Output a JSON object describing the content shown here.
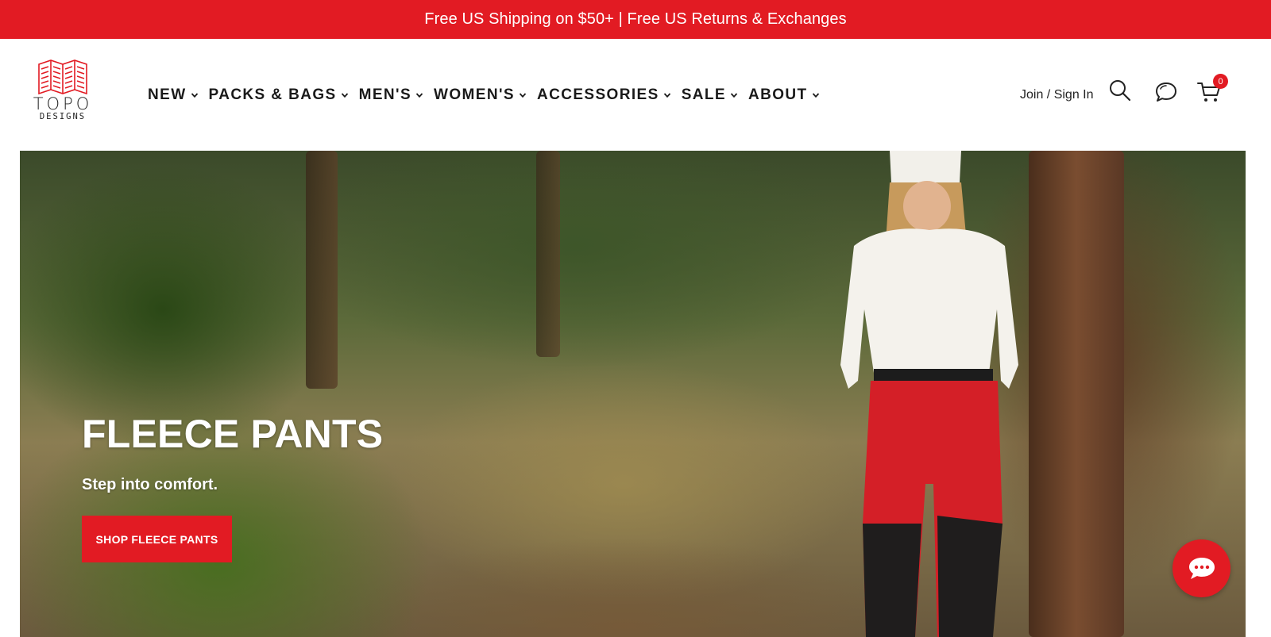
{
  "promo": {
    "text": "Free US Shipping on $50+ | Free US Returns & Exchanges"
  },
  "brand": {
    "line1": "TOPO",
    "line2": "DESIGNS",
    "accent": "#e21b23"
  },
  "nav": {
    "items": [
      {
        "label": "NEW"
      },
      {
        "label": "PACKS & BAGS"
      },
      {
        "label": "MEN'S"
      },
      {
        "label": "WOMEN'S"
      },
      {
        "label": "ACCESSORIES"
      },
      {
        "label": "SALE"
      },
      {
        "label": "ABOUT"
      }
    ]
  },
  "header": {
    "signin_label": "Join / Sign In",
    "cart_count": "0",
    "icons": [
      "search-icon",
      "chat-icon",
      "cart-icon"
    ]
  },
  "hero": {
    "title": "FLEECE PANTS",
    "subtitle": "Step into comfort.",
    "cta_label": "SHOP FLEECE PANTS"
  },
  "chat_widget": {
    "icon": "chat-bubble-icon"
  }
}
